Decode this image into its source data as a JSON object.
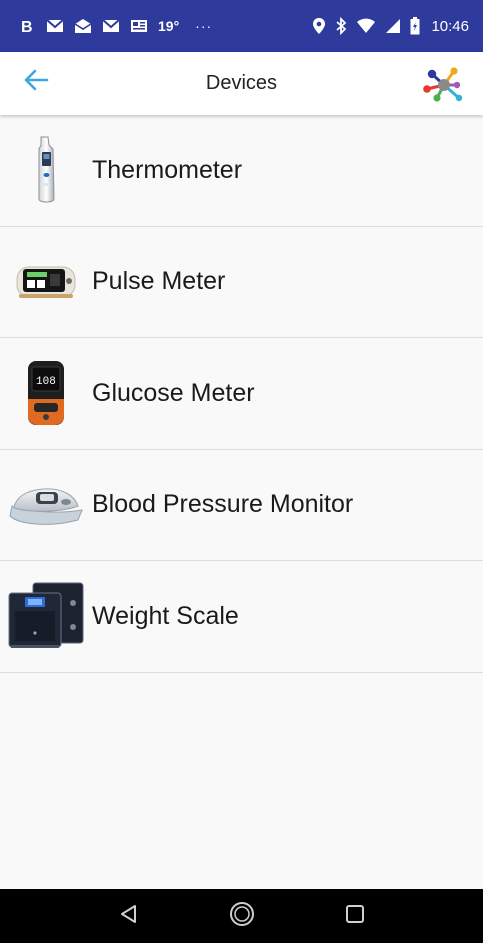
{
  "status_bar": {
    "temperature": "19°",
    "more": "···",
    "time": "10:46",
    "left_icons": [
      "b-app-icon",
      "gmail-icon",
      "mail-open-icon",
      "gmail-icon",
      "news-icon"
    ],
    "right_icons": [
      "location-icon",
      "bluetooth-icon",
      "wifi-icon",
      "signal-icon",
      "battery-icon"
    ]
  },
  "app_bar": {
    "title": "Devices",
    "back_icon": "arrow-left-icon",
    "logo_icon": "network-logo-icon"
  },
  "devices": [
    {
      "label": "Thermometer",
      "icon": "thermometer-device-icon"
    },
    {
      "label": "Pulse Meter",
      "icon": "pulse-oximeter-device-icon"
    },
    {
      "label": "Glucose Meter",
      "icon": "glucose-meter-device-icon",
      "reading": "108"
    },
    {
      "label": "Blood Pressure Monitor",
      "icon": "blood-pressure-cuff-device-icon"
    },
    {
      "label": "Weight Scale",
      "icon": "weight-scale-device-icon"
    }
  ],
  "nav_bar": {
    "back": "nav-back-icon",
    "home": "nav-home-icon",
    "recents": "nav-recents-icon"
  },
  "colors": {
    "status_bar": "#2e3a9c",
    "accent": "#3ba7e6",
    "background": "#f9f9f9"
  }
}
